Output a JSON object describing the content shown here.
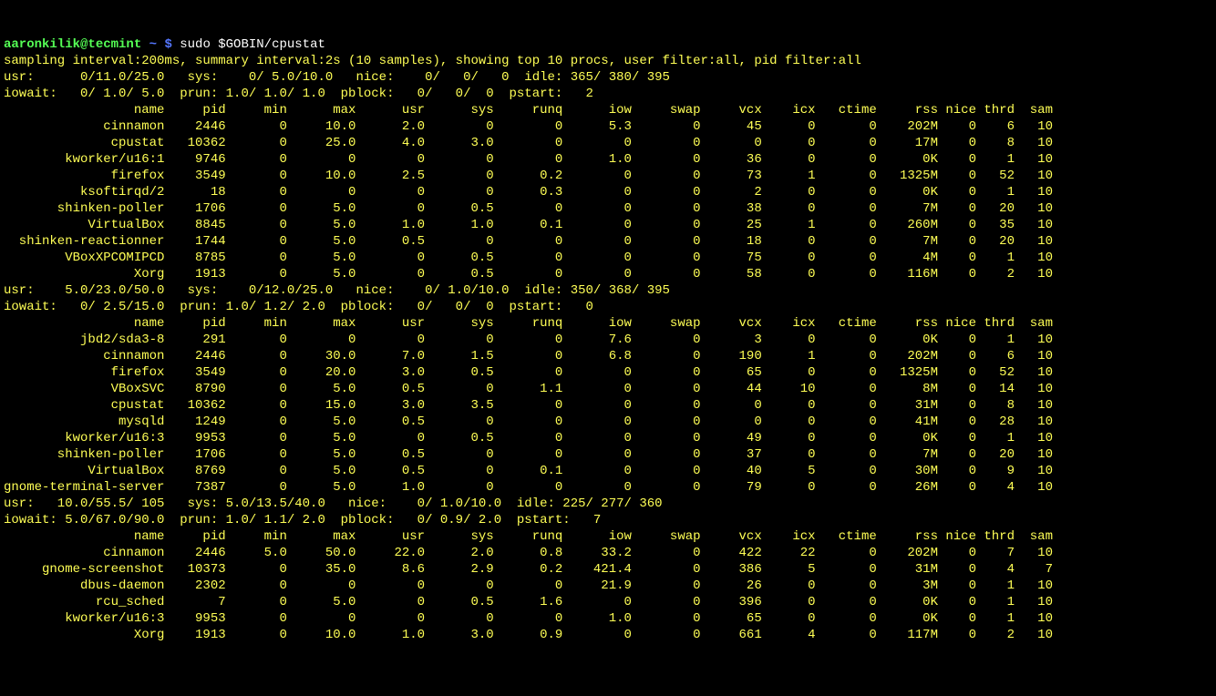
{
  "prompt": {
    "user": "aaronkilik@tecmint",
    "sep": " ~ $ ",
    "cmd": "sudo $GOBIN/cpustat"
  },
  "intro": "sampling interval:200ms, summary interval:2s (10 samples), showing top 10 procs, user filter:all, pid filter:all",
  "headers": [
    "name",
    "pid",
    "min",
    "max",
    "usr",
    "sys",
    "runq",
    "iow",
    "swap",
    "vcx",
    "icx",
    "ctime",
    "rss",
    "nice",
    "thrd",
    "sam"
  ],
  "blocks": [
    {
      "summary": [
        "usr:      0/11.0/25.0   sys:    0/ 5.0/10.0   nice:    0/   0/   0  idle: 365/ 380/ 395",
        "iowait:   0/ 1.0/ 5.0  prun: 1.0/ 1.0/ 1.0  pblock:   0/   0/  0  pstart:   2"
      ],
      "rows": [
        {
          "name": "cinnamon",
          "pid": "2446",
          "min": "0",
          "max": "10.0",
          "usr": "2.0",
          "sys": "0",
          "runq": "0",
          "iow": "5.3",
          "swap": "0",
          "vcx": "45",
          "icx": "0",
          "ctime": "0",
          "rss": "202M",
          "nice": "0",
          "thrd": "6",
          "sam": "10"
        },
        {
          "name": "cpustat",
          "pid": "10362",
          "min": "0",
          "max": "25.0",
          "usr": "4.0",
          "sys": "3.0",
          "runq": "0",
          "iow": "0",
          "swap": "0",
          "vcx": "0",
          "icx": "0",
          "ctime": "0",
          "rss": "17M",
          "nice": "0",
          "thrd": "8",
          "sam": "10"
        },
        {
          "name": "kworker/u16:1",
          "pid": "9746",
          "min": "0",
          "max": "0",
          "usr": "0",
          "sys": "0",
          "runq": "0",
          "iow": "1.0",
          "swap": "0",
          "vcx": "36",
          "icx": "0",
          "ctime": "0",
          "rss": "0K",
          "nice": "0",
          "thrd": "1",
          "sam": "10"
        },
        {
          "name": "firefox",
          "pid": "3549",
          "min": "0",
          "max": "10.0",
          "usr": "2.5",
          "sys": "0",
          "runq": "0.2",
          "iow": "0",
          "swap": "0",
          "vcx": "73",
          "icx": "1",
          "ctime": "0",
          "rss": "1325M",
          "nice": "0",
          "thrd": "52",
          "sam": "10"
        },
        {
          "name": "ksoftirqd/2",
          "pid": "18",
          "min": "0",
          "max": "0",
          "usr": "0",
          "sys": "0",
          "runq": "0.3",
          "iow": "0",
          "swap": "0",
          "vcx": "2",
          "icx": "0",
          "ctime": "0",
          "rss": "0K",
          "nice": "0",
          "thrd": "1",
          "sam": "10"
        },
        {
          "name": "shinken-poller",
          "pid": "1706",
          "min": "0",
          "max": "5.0",
          "usr": "0",
          "sys": "0.5",
          "runq": "0",
          "iow": "0",
          "swap": "0",
          "vcx": "38",
          "icx": "0",
          "ctime": "0",
          "rss": "7M",
          "nice": "0",
          "thrd": "20",
          "sam": "10"
        },
        {
          "name": "VirtualBox",
          "pid": "8845",
          "min": "0",
          "max": "5.0",
          "usr": "1.0",
          "sys": "1.0",
          "runq": "0.1",
          "iow": "0",
          "swap": "0",
          "vcx": "25",
          "icx": "1",
          "ctime": "0",
          "rss": "260M",
          "nice": "0",
          "thrd": "35",
          "sam": "10"
        },
        {
          "name": "shinken-reactionner",
          "pid": "1744",
          "min": "0",
          "max": "5.0",
          "usr": "0.5",
          "sys": "0",
          "runq": "0",
          "iow": "0",
          "swap": "0",
          "vcx": "18",
          "icx": "0",
          "ctime": "0",
          "rss": "7M",
          "nice": "0",
          "thrd": "20",
          "sam": "10"
        },
        {
          "name": "VBoxXPCOMIPCD",
          "pid": "8785",
          "min": "0",
          "max": "5.0",
          "usr": "0",
          "sys": "0.5",
          "runq": "0",
          "iow": "0",
          "swap": "0",
          "vcx": "75",
          "icx": "0",
          "ctime": "0",
          "rss": "4M",
          "nice": "0",
          "thrd": "1",
          "sam": "10"
        },
        {
          "name": "Xorg",
          "pid": "1913",
          "min": "0",
          "max": "5.0",
          "usr": "0",
          "sys": "0.5",
          "runq": "0",
          "iow": "0",
          "swap": "0",
          "vcx": "58",
          "icx": "0",
          "ctime": "0",
          "rss": "116M",
          "nice": "0",
          "thrd": "2",
          "sam": "10"
        }
      ]
    },
    {
      "summary": [
        "usr:    5.0/23.0/50.0   sys:    0/12.0/25.0   nice:    0/ 1.0/10.0  idle: 350/ 368/ 395",
        "iowait:   0/ 2.5/15.0  prun: 1.0/ 1.2/ 2.0  pblock:   0/   0/  0  pstart:   0"
      ],
      "rows": [
        {
          "name": "jbd2/sda3-8",
          "pid": "291",
          "min": "0",
          "max": "0",
          "usr": "0",
          "sys": "0",
          "runq": "0",
          "iow": "7.6",
          "swap": "0",
          "vcx": "3",
          "icx": "0",
          "ctime": "0",
          "rss": "0K",
          "nice": "0",
          "thrd": "1",
          "sam": "10"
        },
        {
          "name": "cinnamon",
          "pid": "2446",
          "min": "0",
          "max": "30.0",
          "usr": "7.0",
          "sys": "1.5",
          "runq": "0",
          "iow": "6.8",
          "swap": "0",
          "vcx": "190",
          "icx": "1",
          "ctime": "0",
          "rss": "202M",
          "nice": "0",
          "thrd": "6",
          "sam": "10"
        },
        {
          "name": "firefox",
          "pid": "3549",
          "min": "0",
          "max": "20.0",
          "usr": "3.0",
          "sys": "0.5",
          "runq": "0",
          "iow": "0",
          "swap": "0",
          "vcx": "65",
          "icx": "0",
          "ctime": "0",
          "rss": "1325M",
          "nice": "0",
          "thrd": "52",
          "sam": "10"
        },
        {
          "name": "VBoxSVC",
          "pid": "8790",
          "min": "0",
          "max": "5.0",
          "usr": "0.5",
          "sys": "0",
          "runq": "1.1",
          "iow": "0",
          "swap": "0",
          "vcx": "44",
          "icx": "10",
          "ctime": "0",
          "rss": "8M",
          "nice": "0",
          "thrd": "14",
          "sam": "10"
        },
        {
          "name": "cpustat",
          "pid": "10362",
          "min": "0",
          "max": "15.0",
          "usr": "3.0",
          "sys": "3.5",
          "runq": "0",
          "iow": "0",
          "swap": "0",
          "vcx": "0",
          "icx": "0",
          "ctime": "0",
          "rss": "31M",
          "nice": "0",
          "thrd": "8",
          "sam": "10"
        },
        {
          "name": "mysqld",
          "pid": "1249",
          "min": "0",
          "max": "5.0",
          "usr": "0.5",
          "sys": "0",
          "runq": "0",
          "iow": "0",
          "swap": "0",
          "vcx": "0",
          "icx": "0",
          "ctime": "0",
          "rss": "41M",
          "nice": "0",
          "thrd": "28",
          "sam": "10"
        },
        {
          "name": "kworker/u16:3",
          "pid": "9953",
          "min": "0",
          "max": "5.0",
          "usr": "0",
          "sys": "0.5",
          "runq": "0",
          "iow": "0",
          "swap": "0",
          "vcx": "49",
          "icx": "0",
          "ctime": "0",
          "rss": "0K",
          "nice": "0",
          "thrd": "1",
          "sam": "10"
        },
        {
          "name": "shinken-poller",
          "pid": "1706",
          "min": "0",
          "max": "5.0",
          "usr": "0.5",
          "sys": "0",
          "runq": "0",
          "iow": "0",
          "swap": "0",
          "vcx": "37",
          "icx": "0",
          "ctime": "0",
          "rss": "7M",
          "nice": "0",
          "thrd": "20",
          "sam": "10"
        },
        {
          "name": "VirtualBox",
          "pid": "8769",
          "min": "0",
          "max": "5.0",
          "usr": "0.5",
          "sys": "0",
          "runq": "0.1",
          "iow": "0",
          "swap": "0",
          "vcx": "40",
          "icx": "5",
          "ctime": "0",
          "rss": "30M",
          "nice": "0",
          "thrd": "9",
          "sam": "10"
        },
        {
          "name": "gnome-terminal-server",
          "pid": "7387",
          "min": "0",
          "max": "5.0",
          "usr": "1.0",
          "sys": "0",
          "runq": "0",
          "iow": "0",
          "swap": "0",
          "vcx": "79",
          "icx": "0",
          "ctime": "0",
          "rss": "26M",
          "nice": "0",
          "thrd": "4",
          "sam": "10"
        }
      ]
    },
    {
      "summary": [
        "usr:   10.0/55.5/ 105   sys: 5.0/13.5/40.0   nice:    0/ 1.0/10.0  idle: 225/ 277/ 360",
        "iowait: 5.0/67.0/90.0  prun: 1.0/ 1.1/ 2.0  pblock:   0/ 0.9/ 2.0  pstart:   7"
      ],
      "rows": [
        {
          "name": "cinnamon",
          "pid": "2446",
          "min": "5.0",
          "max": "50.0",
          "usr": "22.0",
          "sys": "2.0",
          "runq": "0.8",
          "iow": "33.2",
          "swap": "0",
          "vcx": "422",
          "icx": "22",
          "ctime": "0",
          "rss": "202M",
          "nice": "0",
          "thrd": "7",
          "sam": "10"
        },
        {
          "name": "gnome-screenshot",
          "pid": "10373",
          "min": "0",
          "max": "35.0",
          "usr": "8.6",
          "sys": "2.9",
          "runq": "0.2",
          "iow": "421.4",
          "swap": "0",
          "vcx": "386",
          "icx": "5",
          "ctime": "0",
          "rss": "31M",
          "nice": "0",
          "thrd": "4",
          "sam": "7"
        },
        {
          "name": "dbus-daemon",
          "pid": "2302",
          "min": "0",
          "max": "0",
          "usr": "0",
          "sys": "0",
          "runq": "0",
          "iow": "21.9",
          "swap": "0",
          "vcx": "26",
          "icx": "0",
          "ctime": "0",
          "rss": "3M",
          "nice": "0",
          "thrd": "1",
          "sam": "10"
        },
        {
          "name": "rcu_sched",
          "pid": "7",
          "min": "0",
          "max": "5.0",
          "usr": "0",
          "sys": "0.5",
          "runq": "1.6",
          "iow": "0",
          "swap": "0",
          "vcx": "396",
          "icx": "0",
          "ctime": "0",
          "rss": "0K",
          "nice": "0",
          "thrd": "1",
          "sam": "10"
        },
        {
          "name": "kworker/u16:3",
          "pid": "9953",
          "min": "0",
          "max": "0",
          "usr": "0",
          "sys": "0",
          "runq": "0",
          "iow": "1.0",
          "swap": "0",
          "vcx": "65",
          "icx": "0",
          "ctime": "0",
          "rss": "0K",
          "nice": "0",
          "thrd": "1",
          "sam": "10"
        },
        {
          "name": "Xorg",
          "pid": "1913",
          "min": "0",
          "max": "10.0",
          "usr": "1.0",
          "sys": "3.0",
          "runq": "0.9",
          "iow": "0",
          "swap": "0",
          "vcx": "661",
          "icx": "4",
          "ctime": "0",
          "rss": "117M",
          "nice": "0",
          "thrd": "2",
          "sam": "10"
        }
      ]
    }
  ]
}
